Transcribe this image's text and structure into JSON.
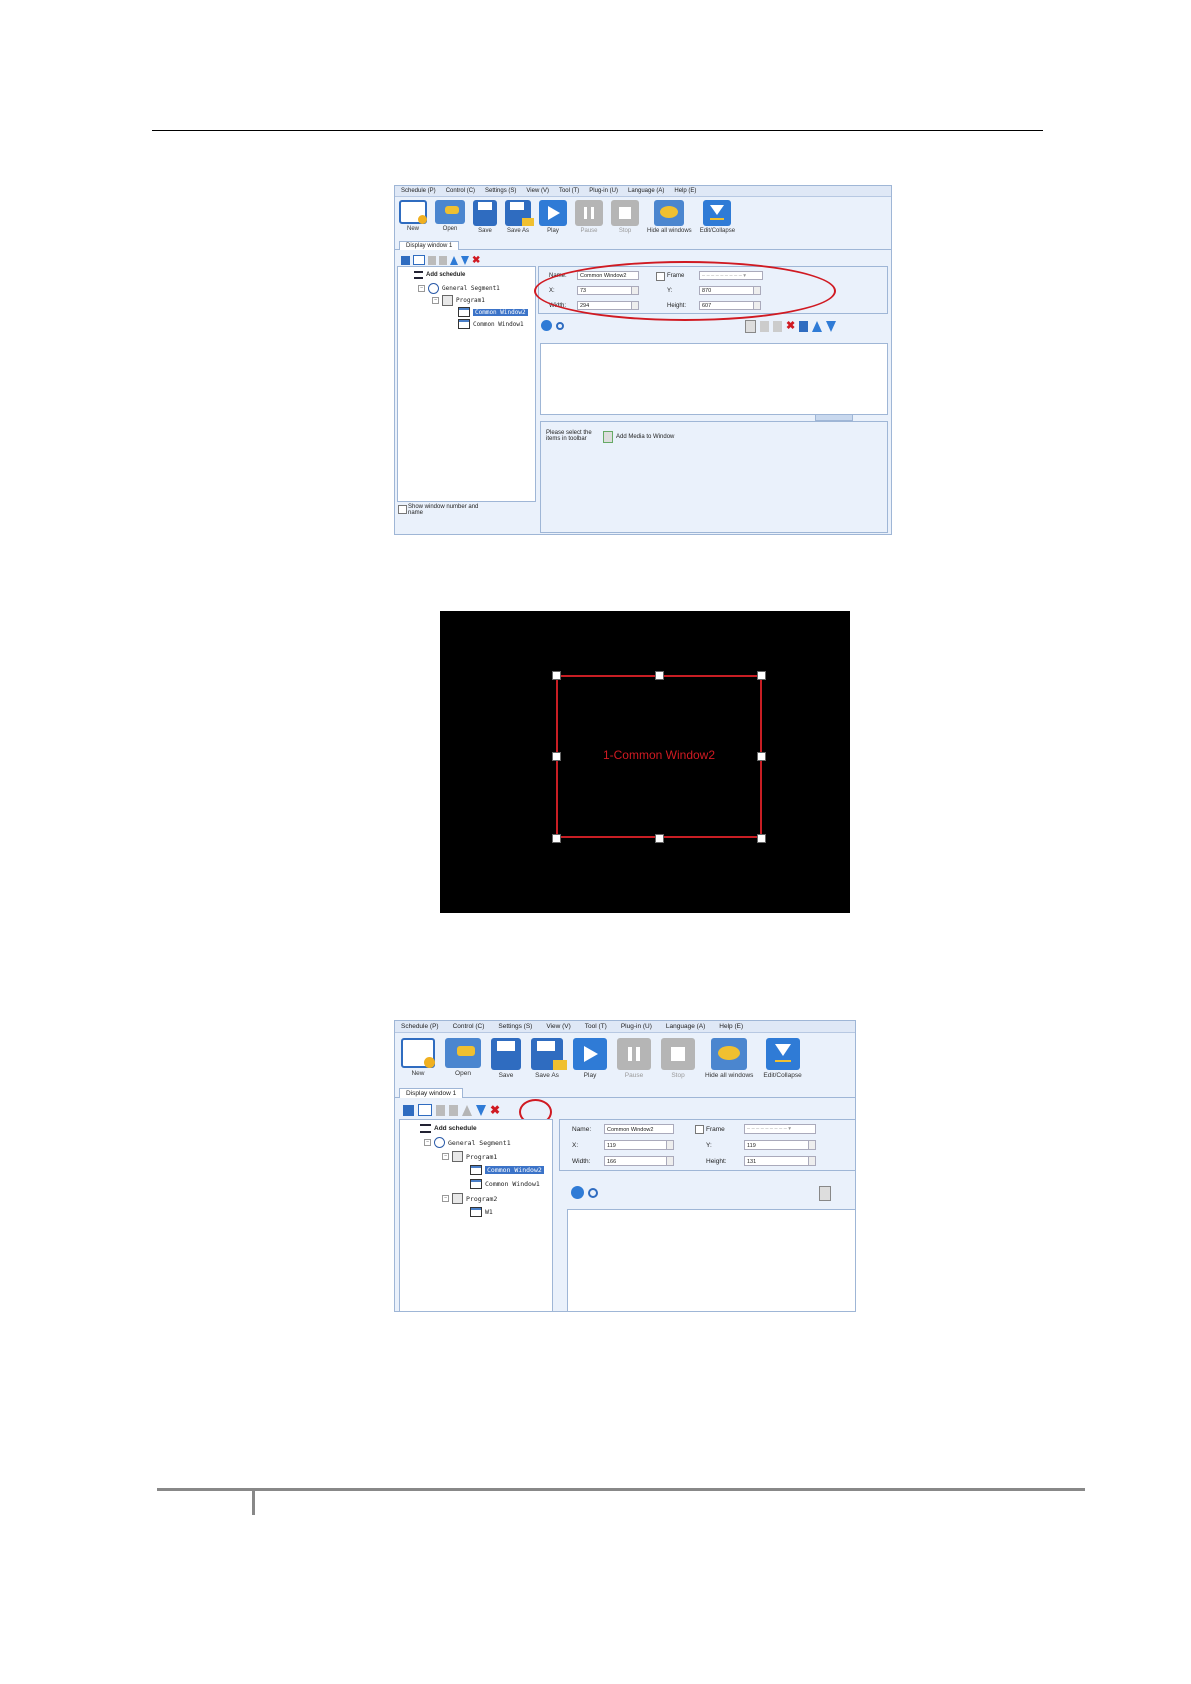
{
  "menu": [
    "Schedule (P)",
    "Control (C)",
    "Settings (S)",
    "View (V)",
    "Tool (T)",
    "Plug-in  (U)",
    "Language (A)",
    "Help (E)"
  ],
  "toolbar": [
    "New",
    "Open",
    "Save",
    "Save As",
    "Play",
    "Pause",
    "Stop",
    "Hide all windows",
    "Edit/Collapse"
  ],
  "tab_label": "Display window 1",
  "tree": {
    "add_schedule": "Add schedule",
    "segment": "General Segment1",
    "program1": "Program1",
    "window_selected": "Common Window2",
    "window_other": "Common Window1",
    "program2": "Program2",
    "w1": "W1"
  },
  "props": {
    "name_label": "Name:",
    "frame_label": "Frame",
    "x_label": "X:",
    "y_label": "Y:",
    "width_label": "Width:",
    "height_label": "Height:"
  },
  "shot1": {
    "name_value": "Common Window2",
    "x_value": "73",
    "y_value": "870",
    "width_value": "294",
    "height_value": "607",
    "hint_text": "Please select the items in toolbar",
    "add_media": "Add Media to Window",
    "show_window": "Show window number and name"
  },
  "shot3": {
    "name_value": "Common Window2",
    "x_value": "119",
    "y_value": "119",
    "width_value": "166",
    "height_value": "131"
  },
  "preview_label": "1-Common Window2",
  "colors": {
    "accent_red": "#d01a22",
    "selection_blue": "#3b73c8",
    "panel_bg": "#eaf1fb"
  }
}
